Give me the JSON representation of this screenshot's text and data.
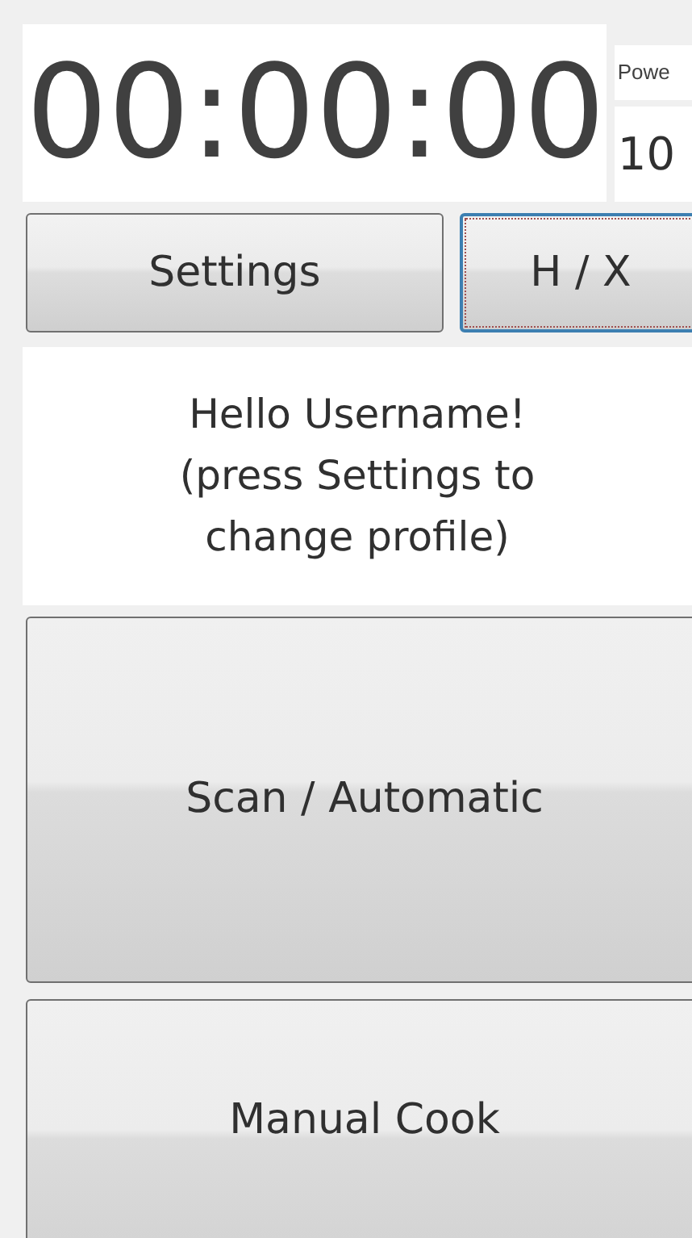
{
  "timer": "00:00:00",
  "power": {
    "label": "Powe",
    "value": "10"
  },
  "top_buttons": [
    {
      "label": "Settings",
      "focused": false
    },
    {
      "label": "H / X",
      "focused": true
    }
  ],
  "greeting": [
    "Hello Username!",
    "(press Settings to",
    "change profile)"
  ],
  "mode_buttons": [
    {
      "label": "Scan / Automatic"
    },
    {
      "label": "Manual Cook"
    }
  ]
}
